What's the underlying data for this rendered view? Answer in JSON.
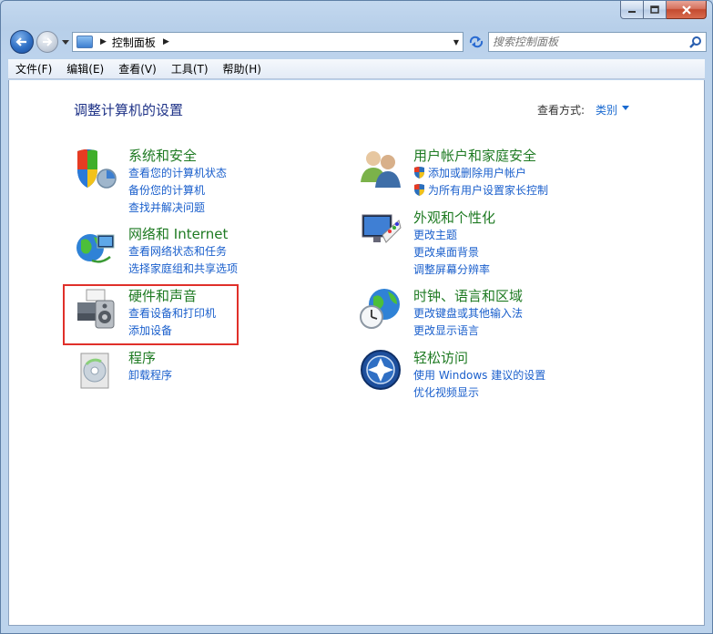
{
  "address": {
    "path": "控制面板"
  },
  "search": {
    "placeholder": "搜索控制面板"
  },
  "menu": [
    "文件(F)",
    "编辑(E)",
    "查看(V)",
    "工具(T)",
    "帮助(H)"
  ],
  "page": {
    "title": "调整计算机的设置",
    "view_by_label": "查看方式:",
    "view_by_value": "类别"
  },
  "categories": {
    "system": {
      "title": "系统和安全",
      "links": [
        "查看您的计算机状态",
        "备份您的计算机",
        "查找并解决问题"
      ]
    },
    "network": {
      "title": "网络和 Internet",
      "links": [
        "查看网络状态和任务",
        "选择家庭组和共享选项"
      ]
    },
    "hardware": {
      "title": "硬件和声音",
      "links": [
        "查看设备和打印机",
        "添加设备"
      ]
    },
    "programs": {
      "title": "程序",
      "links": [
        "卸载程序"
      ]
    },
    "users": {
      "title": "用户帐户和家庭安全",
      "links": [
        "添加或删除用户帐户",
        "为所有用户设置家长控制"
      ]
    },
    "appearance": {
      "title": "外观和个性化",
      "links": [
        "更改主题",
        "更改桌面背景",
        "调整屏幕分辨率"
      ]
    },
    "clock": {
      "title": "时钟、语言和区域",
      "links": [
        "更改键盘或其他输入法",
        "更改显示语言"
      ]
    },
    "ease": {
      "title": "轻松访问",
      "links": [
        "使用 Windows 建议的设置",
        "优化视频显示"
      ]
    }
  },
  "colors": {
    "link": "#1a5fcc",
    "category_title": "#1e7a22",
    "highlight": "#e0302a"
  }
}
